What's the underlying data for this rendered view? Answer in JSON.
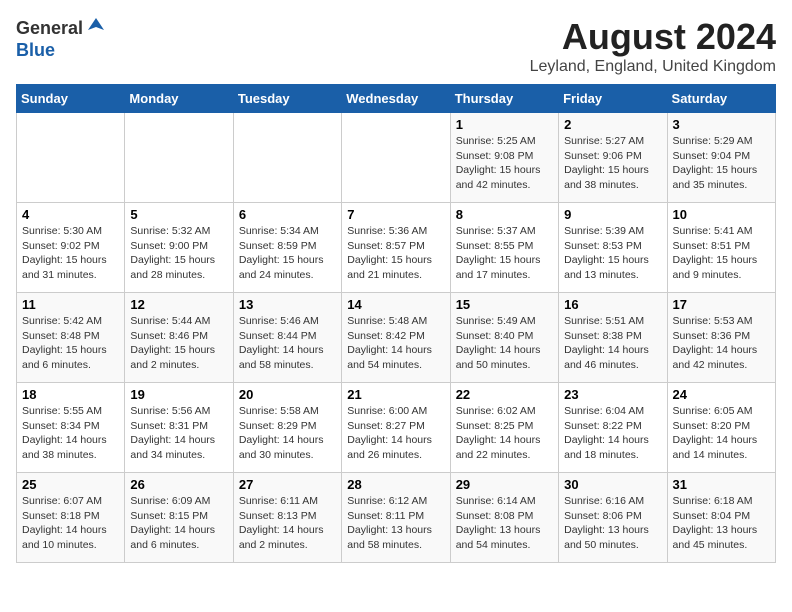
{
  "header": {
    "logo_general": "General",
    "logo_blue": "Blue",
    "month_year": "August 2024",
    "location": "Leyland, England, United Kingdom"
  },
  "weekdays": [
    "Sunday",
    "Monday",
    "Tuesday",
    "Wednesday",
    "Thursday",
    "Friday",
    "Saturday"
  ],
  "weeks": [
    [
      {
        "day": "",
        "info": ""
      },
      {
        "day": "",
        "info": ""
      },
      {
        "day": "",
        "info": ""
      },
      {
        "day": "",
        "info": ""
      },
      {
        "day": "1",
        "info": "Sunrise: 5:25 AM\nSunset: 9:08 PM\nDaylight: 15 hours\nand 42 minutes."
      },
      {
        "day": "2",
        "info": "Sunrise: 5:27 AM\nSunset: 9:06 PM\nDaylight: 15 hours\nand 38 minutes."
      },
      {
        "day": "3",
        "info": "Sunrise: 5:29 AM\nSunset: 9:04 PM\nDaylight: 15 hours\nand 35 minutes."
      }
    ],
    [
      {
        "day": "4",
        "info": "Sunrise: 5:30 AM\nSunset: 9:02 PM\nDaylight: 15 hours\nand 31 minutes."
      },
      {
        "day": "5",
        "info": "Sunrise: 5:32 AM\nSunset: 9:00 PM\nDaylight: 15 hours\nand 28 minutes."
      },
      {
        "day": "6",
        "info": "Sunrise: 5:34 AM\nSunset: 8:59 PM\nDaylight: 15 hours\nand 24 minutes."
      },
      {
        "day": "7",
        "info": "Sunrise: 5:36 AM\nSunset: 8:57 PM\nDaylight: 15 hours\nand 21 minutes."
      },
      {
        "day": "8",
        "info": "Sunrise: 5:37 AM\nSunset: 8:55 PM\nDaylight: 15 hours\nand 17 minutes."
      },
      {
        "day": "9",
        "info": "Sunrise: 5:39 AM\nSunset: 8:53 PM\nDaylight: 15 hours\nand 13 minutes."
      },
      {
        "day": "10",
        "info": "Sunrise: 5:41 AM\nSunset: 8:51 PM\nDaylight: 15 hours\nand 9 minutes."
      }
    ],
    [
      {
        "day": "11",
        "info": "Sunrise: 5:42 AM\nSunset: 8:48 PM\nDaylight: 15 hours\nand 6 minutes."
      },
      {
        "day": "12",
        "info": "Sunrise: 5:44 AM\nSunset: 8:46 PM\nDaylight: 15 hours\nand 2 minutes."
      },
      {
        "day": "13",
        "info": "Sunrise: 5:46 AM\nSunset: 8:44 PM\nDaylight: 14 hours\nand 58 minutes."
      },
      {
        "day": "14",
        "info": "Sunrise: 5:48 AM\nSunset: 8:42 PM\nDaylight: 14 hours\nand 54 minutes."
      },
      {
        "day": "15",
        "info": "Sunrise: 5:49 AM\nSunset: 8:40 PM\nDaylight: 14 hours\nand 50 minutes."
      },
      {
        "day": "16",
        "info": "Sunrise: 5:51 AM\nSunset: 8:38 PM\nDaylight: 14 hours\nand 46 minutes."
      },
      {
        "day": "17",
        "info": "Sunrise: 5:53 AM\nSunset: 8:36 PM\nDaylight: 14 hours\nand 42 minutes."
      }
    ],
    [
      {
        "day": "18",
        "info": "Sunrise: 5:55 AM\nSunset: 8:34 PM\nDaylight: 14 hours\nand 38 minutes."
      },
      {
        "day": "19",
        "info": "Sunrise: 5:56 AM\nSunset: 8:31 PM\nDaylight: 14 hours\nand 34 minutes."
      },
      {
        "day": "20",
        "info": "Sunrise: 5:58 AM\nSunset: 8:29 PM\nDaylight: 14 hours\nand 30 minutes."
      },
      {
        "day": "21",
        "info": "Sunrise: 6:00 AM\nSunset: 8:27 PM\nDaylight: 14 hours\nand 26 minutes."
      },
      {
        "day": "22",
        "info": "Sunrise: 6:02 AM\nSunset: 8:25 PM\nDaylight: 14 hours\nand 22 minutes."
      },
      {
        "day": "23",
        "info": "Sunrise: 6:04 AM\nSunset: 8:22 PM\nDaylight: 14 hours\nand 18 minutes."
      },
      {
        "day": "24",
        "info": "Sunrise: 6:05 AM\nSunset: 8:20 PM\nDaylight: 14 hours\nand 14 minutes."
      }
    ],
    [
      {
        "day": "25",
        "info": "Sunrise: 6:07 AM\nSunset: 8:18 PM\nDaylight: 14 hours\nand 10 minutes."
      },
      {
        "day": "26",
        "info": "Sunrise: 6:09 AM\nSunset: 8:15 PM\nDaylight: 14 hours\nand 6 minutes."
      },
      {
        "day": "27",
        "info": "Sunrise: 6:11 AM\nSunset: 8:13 PM\nDaylight: 14 hours\nand 2 minutes."
      },
      {
        "day": "28",
        "info": "Sunrise: 6:12 AM\nSunset: 8:11 PM\nDaylight: 13 hours\nand 58 minutes."
      },
      {
        "day": "29",
        "info": "Sunrise: 6:14 AM\nSunset: 8:08 PM\nDaylight: 13 hours\nand 54 minutes."
      },
      {
        "day": "30",
        "info": "Sunrise: 6:16 AM\nSunset: 8:06 PM\nDaylight: 13 hours\nand 50 minutes."
      },
      {
        "day": "31",
        "info": "Sunrise: 6:18 AM\nSunset: 8:04 PM\nDaylight: 13 hours\nand 45 minutes."
      }
    ]
  ]
}
